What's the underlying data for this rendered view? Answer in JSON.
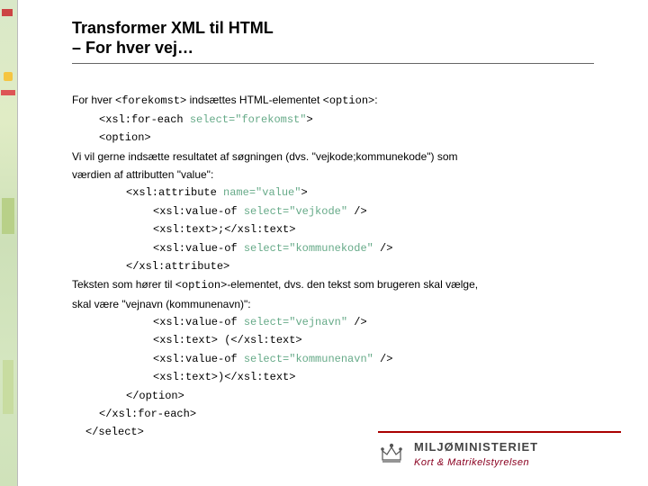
{
  "title": "Transformer XML til HTML",
  "subtitle": "– For hver vej…",
  "para1": {
    "pre": "For hver ",
    "tag1": "<forekomst>",
    "mid": " indsættes HTML-elementet ",
    "tag2": "<option>",
    "post": ":"
  },
  "code1": {
    "line1a": "<xsl:for-each ",
    "line1b": "select=\"forekomst\"",
    "line1c": ">",
    "line2": "<option>"
  },
  "para2": "Vi vil gerne indsætte resultatet af søgningen (dvs. \"vejkode;kommunekode\") som",
  "para2b": "værdien af attributten \"value\":",
  "code2": {
    "l1a": "<xsl:attribute ",
    "l1b": "name=\"value\"",
    "l1c": ">",
    "l2a": "<xsl:value-of ",
    "l2b": "select=\"vejkode\"",
    "l2c": " />",
    "l3": "<xsl:text>;</xsl:text>",
    "l4a": "<xsl:value-of ",
    "l4b": "select=\"kommunekode\"",
    "l4c": " />",
    "l5": "</xsl:attribute>"
  },
  "para3a": "Teksten som hører til ",
  "para3tag": "<option>",
  "para3b": "-elementet, dvs. den tekst som brugeren skal vælge,",
  "para3c": "skal være \"vejnavn (kommunenavn)\":",
  "code3": {
    "l1a": "<xsl:value-of ",
    "l1b": "select=\"vejnavn\"",
    "l1c": " />",
    "l2": "<xsl:text> (</xsl:text>",
    "l3a": "<xsl:value-of ",
    "l3b": "select=\"kommunenavn\"",
    "l3c": " />",
    "l4": "<xsl:text>)</xsl:text>",
    "l5": "</option>",
    "l6": "</xsl:for-each>",
    "l7": "</select>"
  },
  "footer": {
    "org": "MILJØMINISTERIET",
    "sub": "Kort & Matrikelstyrelsen"
  }
}
